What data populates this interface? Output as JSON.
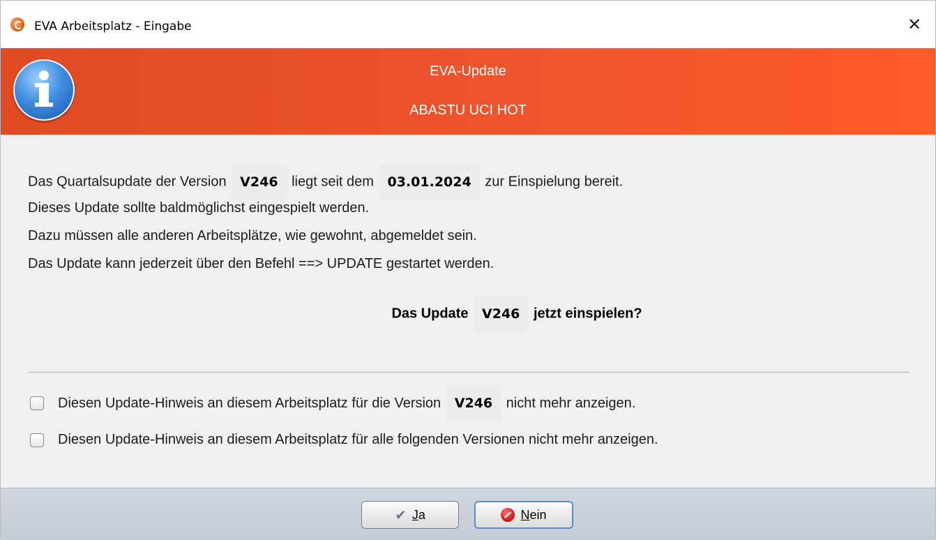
{
  "window": {
    "title": "EVA Arbeitsplatz - Eingabe",
    "close_symbol": "✕"
  },
  "banner": {
    "title": "EVA-Update",
    "subtitle": "ABASTU UCI HOT",
    "icon": "info-icon"
  },
  "message": {
    "line1_pre": "Das Quartalsupdate der Version",
    "version": "V246",
    "line1_mid": "liegt seit dem",
    "date": "03.01.2024",
    "line1_post": "zur Einspielung bereit.",
    "line2": "Dieses Update sollte baldmöglichst eingespielt werden.",
    "line3": "Dazu müssen alle anderen Arbeitsplätze, wie gewohnt, abgemeldet sein.",
    "line4": "Das Update kann jederzeit über den Befehl ==> UPDATE gestartet werden."
  },
  "question": {
    "pre": "Das Update",
    "version": "V246",
    "post": "jetzt einspielen?"
  },
  "options": {
    "opt1_pre": "Diesen Update-Hinweis an diesem Arbeitsplatz für die Version",
    "opt1_version": "V246",
    "opt1_post": "nicht mehr anzeigen.",
    "opt1_checked": false,
    "opt2": "Diesen Update-Hinweis an diesem Arbeitsplatz für alle folgenden Versionen nicht mehr anzeigen.",
    "opt2_checked": false
  },
  "buttons": {
    "yes_mnemonic": "J",
    "yes_rest": "a",
    "no_mnemonic": "N",
    "no_rest": "ein"
  },
  "colors": {
    "banner": "#f0552c",
    "footer": "#c9d0d9",
    "default_button_border": "#5b8dc9"
  }
}
